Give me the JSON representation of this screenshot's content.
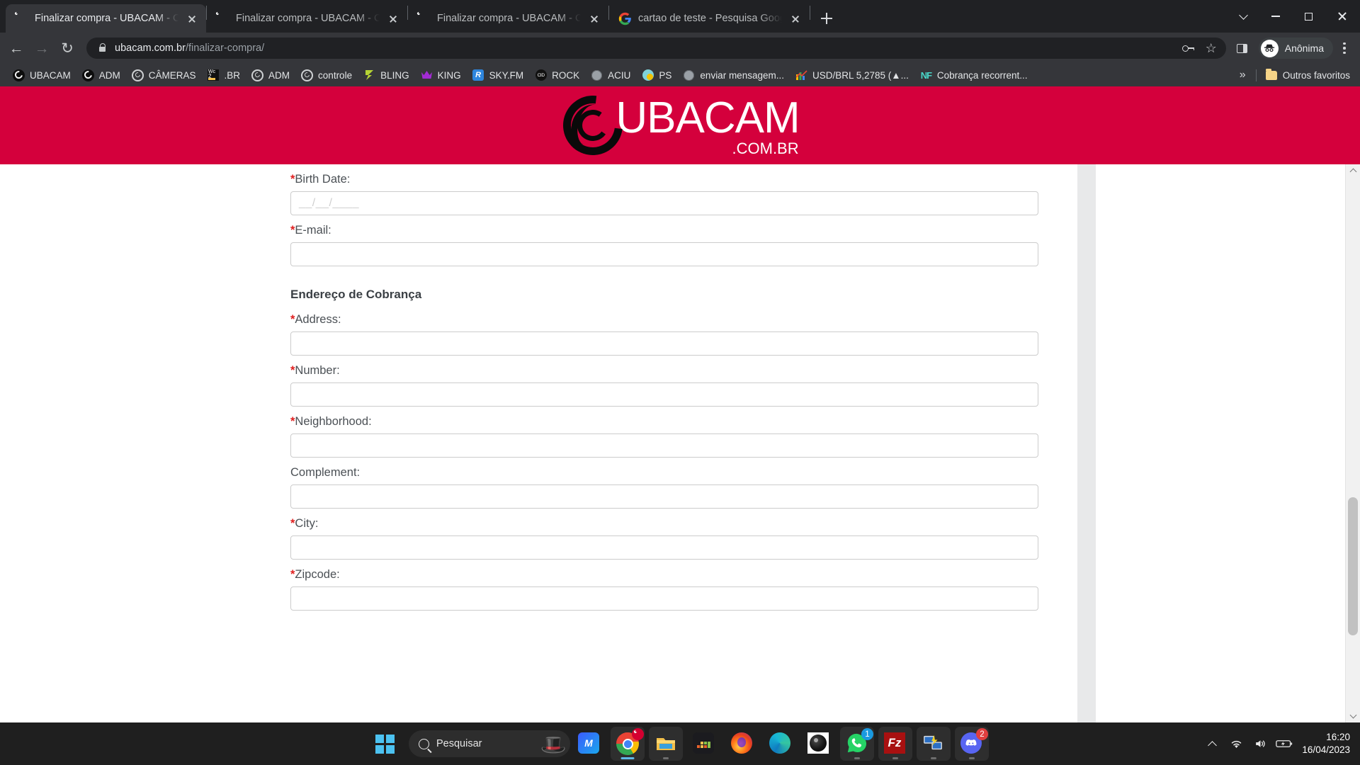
{
  "browser": {
    "tabs": [
      {
        "title": "Finalizar compra - UBACAM - CÂ",
        "icon": "ubacam-favicon",
        "active": true
      },
      {
        "title": "Finalizar compra - UBACAM - CÂ",
        "icon": "ubacam-favicon",
        "active": false
      },
      {
        "title": "Finalizar compra - UBACAM - CÂ",
        "icon": "ubacam-favicon",
        "active": false
      },
      {
        "title": "cartao de teste - Pesquisa Google",
        "icon": "google-favicon",
        "active": false
      }
    ],
    "new_tab_label": "+",
    "window_controls": {
      "minimize": "–",
      "maximize": "□",
      "close": "✕"
    },
    "omnibox": {
      "domain": "ubacam.com.br",
      "path": "/finalizar-compra/",
      "security": "lock-icon"
    },
    "profile_label": "Anônima",
    "bookmarks": [
      {
        "label": "UBACAM",
        "icon": "ubacam-favicon"
      },
      {
        "label": "ADM",
        "icon": "ubacam-favicon"
      },
      {
        "label": "CÂMERAS",
        "icon": "ubacam-outline-favicon"
      },
      {
        "label": ".BR",
        "icon": "wc2-favicon"
      },
      {
        "label": "ADM",
        "icon": "ubacam-outline-favicon"
      },
      {
        "label": "controle",
        "icon": "ubacam-outline-favicon"
      },
      {
        "label": "BLING",
        "icon": "bling-favicon"
      },
      {
        "label": "KING",
        "icon": "crown-favicon"
      },
      {
        "label": "SKY.FM",
        "icon": "skyfm-favicon"
      },
      {
        "label": "ROCK",
        "icon": "cid-favicon"
      },
      {
        "label": "ACIU",
        "icon": "globe-favicon"
      },
      {
        "label": "PS",
        "icon": "ps-favicon"
      },
      {
        "label": "enviar mensagem...",
        "icon": "globe-favicon"
      },
      {
        "label": "USD/BRL 5,2785 (▲...",
        "icon": "chart-favicon"
      },
      {
        "label": "Cobrança recorrent...",
        "icon": "nf-favicon"
      }
    ],
    "bookmarks_overflow": "»",
    "other_bookmarks_label": "Outros favoritos"
  },
  "page": {
    "logo": {
      "main": "UBACAM",
      "sub": ".COM.BR",
      "brand_color": "#d4003c"
    },
    "sections": [
      {
        "type": "field",
        "label": "Birth Date:",
        "required": true,
        "value": "",
        "placeholder": "__/__/____"
      },
      {
        "type": "field",
        "label": "E-mail:",
        "required": true,
        "value": "",
        "placeholder": ""
      },
      {
        "type": "heading",
        "label": "Endereço de Cobrança"
      },
      {
        "type": "field",
        "label": "Address:",
        "required": true,
        "value": "",
        "placeholder": ""
      },
      {
        "type": "field",
        "label": "Number:",
        "required": true,
        "value": "",
        "placeholder": ""
      },
      {
        "type": "field",
        "label": "Neighborhood:",
        "required": true,
        "value": "",
        "placeholder": ""
      },
      {
        "type": "field",
        "label": "Complement:",
        "required": false,
        "value": "",
        "placeholder": ""
      },
      {
        "type": "field",
        "label": "City:",
        "required": true,
        "value": "",
        "placeholder": ""
      },
      {
        "type": "field",
        "label": "Zipcode:",
        "required": true,
        "value": "",
        "placeholder": ""
      }
    ],
    "required_marker": "*"
  },
  "taskbar": {
    "start_label": "windows-logo",
    "search_placeholder": "Pesquisar",
    "apps": [
      {
        "name": "app-monad",
        "running": false,
        "badge": null
      },
      {
        "name": "google-chrome",
        "running": true,
        "active": true,
        "badge": null
      },
      {
        "name": "file-explorer",
        "running": true,
        "badge": null
      },
      {
        "name": "app-dark-grid",
        "running": false,
        "badge": null
      },
      {
        "name": "mozilla-firefox",
        "running": false,
        "badge": null
      },
      {
        "name": "microsoft-edge",
        "running": false,
        "badge": null
      },
      {
        "name": "camera-viewer",
        "running": false,
        "badge": null
      },
      {
        "name": "whatsapp",
        "running": true,
        "badge": "1"
      },
      {
        "name": "filezilla",
        "running": true,
        "badge": null
      },
      {
        "name": "remote-desktop",
        "running": true,
        "badge": null
      },
      {
        "name": "discord",
        "running": true,
        "badge": "2"
      }
    ],
    "tray": {
      "overflow": "show-hidden-icons",
      "wifi": "wifi-icon",
      "volume": "volume-icon",
      "battery": "battery-charging-icon",
      "time": "16:20",
      "date": "16/04/2023"
    }
  }
}
